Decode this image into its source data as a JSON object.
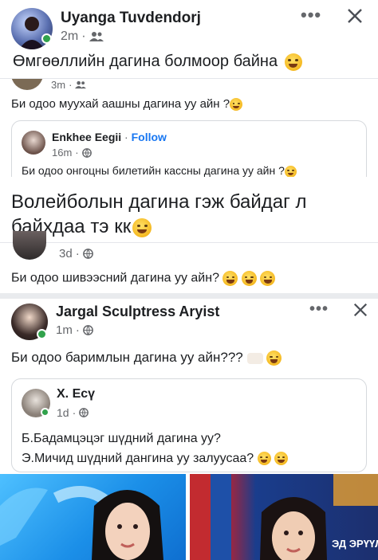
{
  "post1": {
    "author": "Uyanga Tuvdendorj",
    "time": "2m",
    "audience_icon": "friends-icon",
    "text": "Өмгөөллийн дагина болмоор байна"
  },
  "post2": {
    "time": "3m",
    "text": "Би одоо муухай аашны дагина уу айн ?",
    "shared": {
      "author": "Enkhee Eegii",
      "follow_label": "Follow",
      "time": "16m",
      "text": "Би одоо онгоцны билетийн кассны дагина уу айн ?"
    }
  },
  "post3": {
    "text_line1": "Волейболын дагина гэж байдаг л",
    "text_line2": "байхдаа тэ кк",
    "time": "3d",
    "body": "Би одоо шивээсний дагина уу айн?"
  },
  "post4": {
    "author": "Jargal Sculptress Aryist",
    "time": "1m",
    "text": "Би одоо баримлын дагина уу айн???",
    "shared": {
      "author": "Х. Есү",
      "time": "1d",
      "line1": "Б.Бадамцэцэг шүдний дагина уу?",
      "line2": "Э.Мичид шүдний дангина уу залуусаа?"
    },
    "photo_right_banner": "ЭД ЭРҮҮЛ И"
  },
  "colors": {
    "accent": "#1877f2",
    "online": "#31a24c",
    "divider": "#e9ebee",
    "meta": "#65676b"
  }
}
